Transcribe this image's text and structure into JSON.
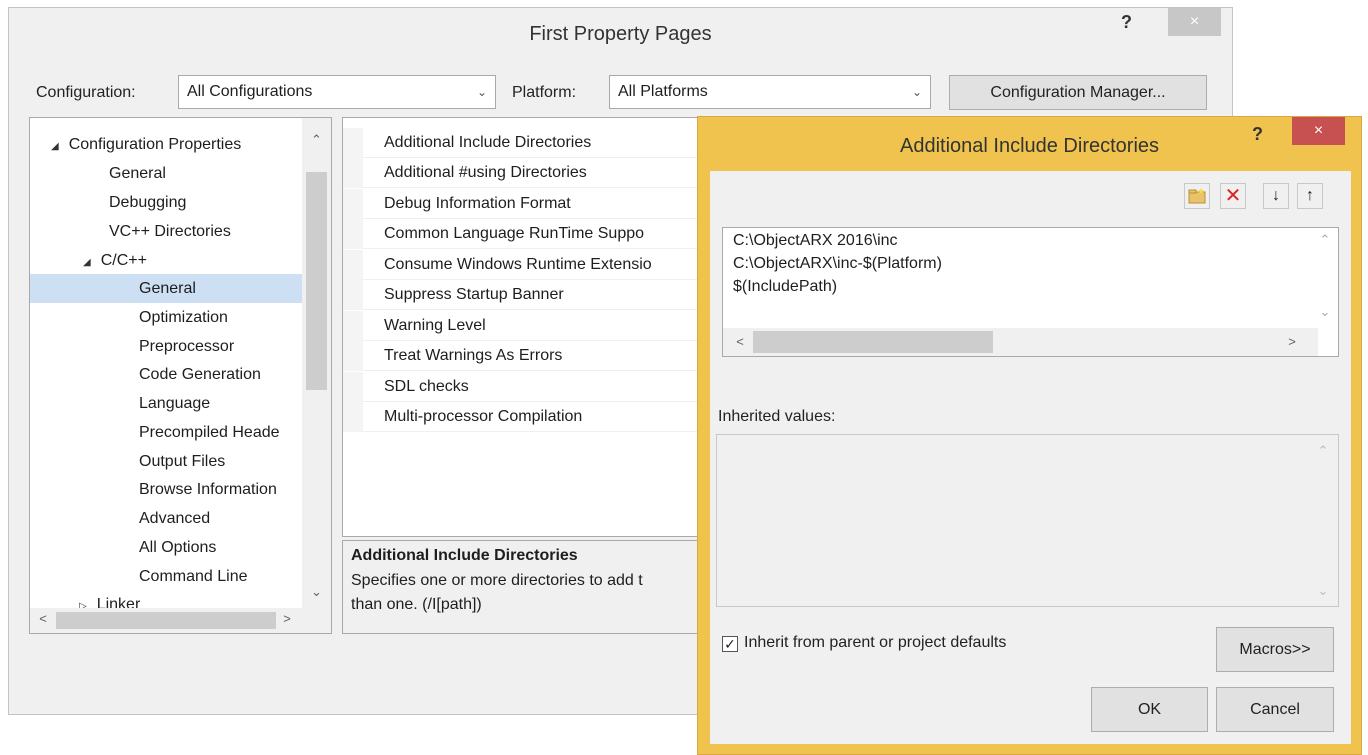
{
  "main_window": {
    "title": "First Property Pages",
    "help": "?",
    "close": "×",
    "configuration_label": "Configuration:",
    "configuration_value": "All Configurations",
    "platform_label": "Platform:",
    "platform_value": "All Platforms",
    "config_manager_button": "Configuration Manager...",
    "tree": [
      {
        "label": "Configuration Properties",
        "expander": "◢"
      },
      {
        "label": "General"
      },
      {
        "label": "Debugging"
      },
      {
        "label": "VC++ Directories"
      },
      {
        "label": "C/C++",
        "expander": "◢"
      },
      {
        "label": "General",
        "selected": true
      },
      {
        "label": "Optimization"
      },
      {
        "label": "Preprocessor"
      },
      {
        "label": "Code Generation"
      },
      {
        "label": "Language"
      },
      {
        "label": "Precompiled Heade"
      },
      {
        "label": "Output Files"
      },
      {
        "label": "Browse Information"
      },
      {
        "label": "Advanced"
      },
      {
        "label": "All Options"
      },
      {
        "label": "Command Line"
      },
      {
        "label": "Linker",
        "expander": "▷"
      }
    ],
    "properties": [
      "Additional Include Directories",
      "Additional #using Directories",
      "Debug Information Format",
      "Common Language RunTime Suppo",
      "Consume Windows Runtime Extensio",
      "Suppress Startup Banner",
      "Warning Level",
      "Treat Warnings As Errors",
      "SDL checks",
      "Multi-processor Compilation"
    ],
    "description": {
      "title": "Additional Include Directories",
      "text": "Specifies one or more directories to add t\nthan one.    (/I[path])"
    }
  },
  "dialog": {
    "title": "Additional Include Directories",
    "help": "?",
    "close": "×",
    "toolbar": {
      "new_line_icon": "folder-new-icon",
      "delete_icon": "delete-icon",
      "move_down_icon": "arrow-down-icon",
      "move_up_icon": "arrow-up-icon"
    },
    "entries": [
      "C:\\ObjectARX 2016\\inc",
      "C:\\ObjectARX\\inc-$(Platform)",
      "$(IncludePath)"
    ],
    "inherited_label": "Inherited values:",
    "inherit_checkbox_label": "Inherit from parent or project defaults",
    "inherit_checked": true,
    "macros_button": "Macros>>",
    "ok_button": "OK",
    "cancel_button": "Cancel"
  }
}
